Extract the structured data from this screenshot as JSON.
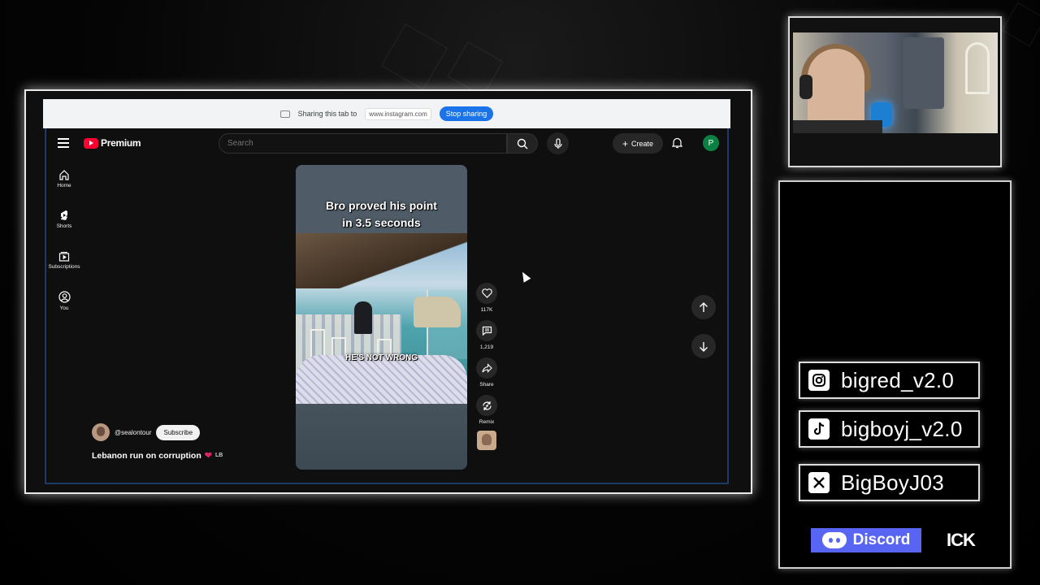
{
  "share_bar": {
    "text": "Sharing this tab to",
    "url": "www.instagram.com",
    "stop_label": "Stop sharing"
  },
  "youtube": {
    "logo_text": "Premium",
    "search_placeholder": "Search",
    "create_label": "Create",
    "avatar_letter": "P",
    "sidebar": [
      {
        "label": "Home",
        "icon": "home-icon"
      },
      {
        "label": "Shorts",
        "icon": "shorts-icon"
      },
      {
        "label": "Subscriptions",
        "icon": "subscriptions-icon"
      },
      {
        "label": "You",
        "icon": "you-icon"
      }
    ],
    "short": {
      "caption_line1": "Bro proved his point",
      "caption_line2": "in 3.5 seconds",
      "overlay": "HE'S NOT WRONG"
    },
    "actions": {
      "likes": "117K",
      "comments": "1,219",
      "share": "Share",
      "remix": "Remix"
    },
    "channel": {
      "handle": "@sealontour",
      "subscribe_label": "Subscribe"
    },
    "video_title": "Lebanon run on corruption",
    "title_flag": "LB"
  },
  "socials": {
    "instagram": "bigred_v2.0",
    "tiktok": "bigboyj_v2.0",
    "x": "BigBoyJ03",
    "discord_label": "Discord",
    "ick": "ICK"
  },
  "colors": {
    "youtube_red": "#ff0033",
    "stop_sharing_blue": "#1a73e8",
    "discord_blurple": "#5865f2",
    "avatar_green": "#0b8043"
  }
}
